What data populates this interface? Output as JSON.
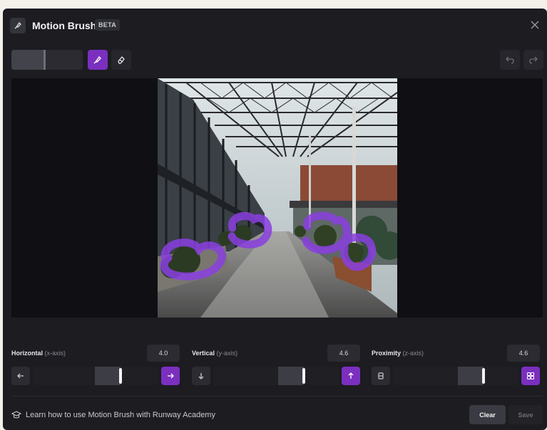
{
  "header": {
    "title": "Motion Brush",
    "badge": "BETA",
    "logo_icon": "brush-icon",
    "close_icon": "close-icon"
  },
  "toolbar": {
    "brush_size_level": 0.48,
    "tools": [
      "brush-icon",
      "eraser-icon"
    ],
    "active_tool": "brush",
    "history": [
      "undo-icon",
      "redo-icon"
    ]
  },
  "canvas": {
    "photo": "glass-roofed industrial atrium corridor with planters, four regions painted in purple"
  },
  "controls": {
    "horizontal": {
      "label": "Horizontal",
      "axis": "(x-axis)",
      "value": "4.0",
      "level": 0.7,
      "left_icon": "arrow-left-icon",
      "right_icon": "arrow-right-icon"
    },
    "vertical": {
      "label": "Vertical",
      "axis": "(y-axis)",
      "value": "4.6",
      "level": 0.72,
      "left_icon": "arrow-down-icon",
      "right_icon": "arrow-up-icon"
    },
    "proximity": {
      "label": "Proximity",
      "axis": "(z-axis)",
      "value": "4.6",
      "level": 0.72,
      "left_icon": "proximity-far-icon",
      "right_icon": "proximity-near-icon"
    }
  },
  "footer": {
    "learn_text": "Learn how to use Motion Brush with Runway Academy",
    "learn_icon": "graduation-cap-icon",
    "clear_label": "Clear",
    "save_label": "Save"
  },
  "colors": {
    "accent": "#7b2fbf",
    "background": "#1c1c21",
    "panel": "#2b2b31"
  }
}
